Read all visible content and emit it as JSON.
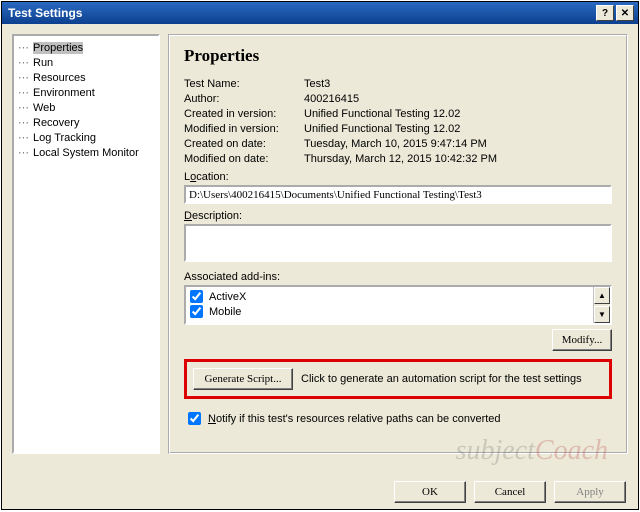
{
  "title": "Test Settings",
  "tree": {
    "items": [
      {
        "label": "Properties",
        "selected": true
      },
      {
        "label": "Run"
      },
      {
        "label": "Resources"
      },
      {
        "label": "Environment"
      },
      {
        "label": "Web"
      },
      {
        "label": "Recovery"
      },
      {
        "label": "Log Tracking"
      },
      {
        "label": "Local System Monitor"
      }
    ]
  },
  "panel": {
    "heading": "Properties",
    "fields": {
      "testname_k": "Test Name:",
      "testname_v": "Test3",
      "author_k": "Author:",
      "author_v": "400216415",
      "createdver_k": "Created in version:",
      "createdver_v": "Unified Functional Testing 12.02",
      "modver_k": "Modified in version:",
      "modver_v": "Unified Functional Testing 12.02",
      "createdon_k": "Created on date:",
      "createdon_v": "Tuesday, March 10, 2015  9:47:14 PM",
      "modon_k": "Modified on date:",
      "modon_v": "Thursday, March 12, 2015  10:42:32 PM"
    },
    "location_label_pre": "L",
    "location_label_u": "o",
    "location_label_post": "cation:",
    "location": "D:\\Users\\400216415\\Documents\\Unified Functional Testing\\Test3",
    "description_label_u": "D",
    "description_label_post": "escription:",
    "description": "",
    "addins_label": "Associated add-ins:",
    "addins": [
      {
        "name": "ActiveX",
        "checked": true
      },
      {
        "name": "Mobile",
        "checked": true
      }
    ],
    "modify_btn_u": "M",
    "modify_btn_post": "odify...",
    "gen_btn_u": "G",
    "gen_btn_post": "enerate Script...",
    "gen_text": "Click to generate an automation script for the test settings",
    "notify_checked": true,
    "notify_u": "N",
    "notify_post": "otify if this test's resources relative paths can be converted"
  },
  "buttons": {
    "ok": "OK",
    "cancel": "Cancel",
    "apply": "Apply"
  },
  "watermark": {
    "a": "subject",
    "b": "Coach"
  }
}
